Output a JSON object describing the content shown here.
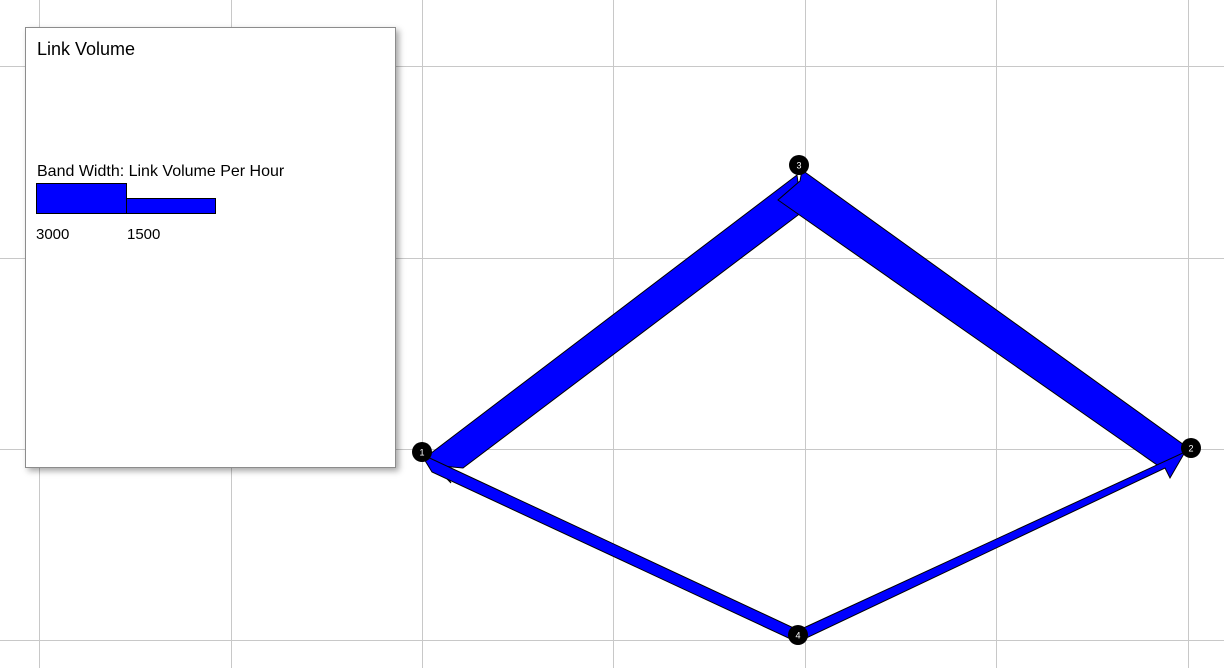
{
  "legend": {
    "title": "Link Volume",
    "subtitle": "Band Width: Link Volume Per Hour",
    "scale": [
      {
        "label": "3000",
        "value": 3000
      },
      {
        "label": "1500",
        "value": 1500
      }
    ]
  },
  "network": {
    "nodes": [
      {
        "id": "1",
        "label": "1"
      },
      {
        "id": "2",
        "label": "2"
      },
      {
        "id": "3",
        "label": "3"
      },
      {
        "id": "4",
        "label": "4"
      }
    ],
    "links": [
      {
        "from": "1",
        "to": "3"
      },
      {
        "from": "3",
        "to": "2"
      },
      {
        "from": "1",
        "to": "4"
      },
      {
        "from": "4",
        "to": "2"
      }
    ]
  },
  "colors": {
    "band": "#0000ff",
    "node": "#000000",
    "node_label": "#ffffff",
    "grid": "#c8c8c8",
    "background": "#ffffff"
  }
}
